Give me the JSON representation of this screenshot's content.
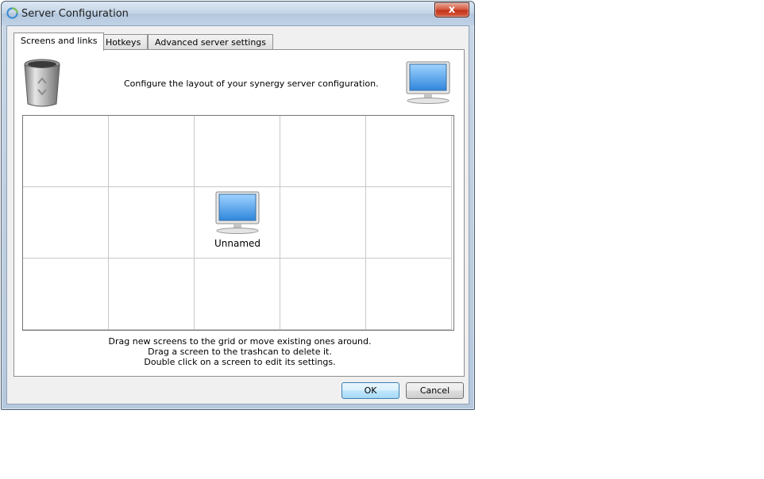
{
  "window": {
    "title": "Server Configuration",
    "close_label": "x"
  },
  "tabs": [
    {
      "label": "Screens and links",
      "active": true
    },
    {
      "label": "Hotkeys",
      "active": false
    },
    {
      "label": "Advanced server settings",
      "active": false
    }
  ],
  "panel": {
    "header_text": "Configure the layout of your synergy server configuration.",
    "trash_icon": "trashcan-icon",
    "new_screen_icon": "monitor-icon",
    "grid": {
      "columns": 5,
      "rows": 3,
      "screens": [
        {
          "name": "Unnamed",
          "row": 1,
          "col": 2
        }
      ]
    },
    "help_lines": [
      "Drag new screens to the grid or move existing ones around.",
      "Drag a screen to the trashcan to delete it.",
      "Double click on a screen to edit its settings."
    ]
  },
  "buttons": {
    "ok": "OK",
    "cancel": "Cancel"
  },
  "colors": {
    "monitor_screen": "#3a8fe0",
    "default_button_border": "#3c7fb1"
  }
}
